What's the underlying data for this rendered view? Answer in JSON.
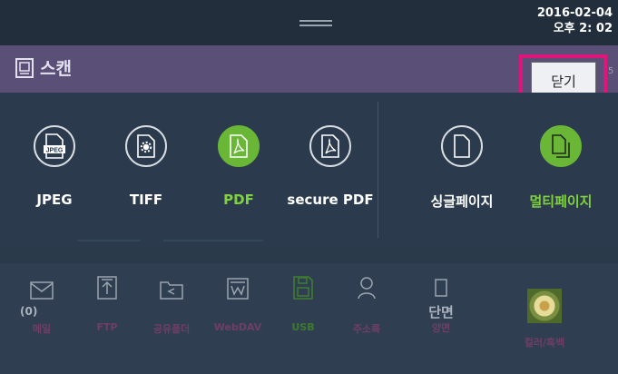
{
  "status_bar": {
    "date": "2016-02-04",
    "time": "오후 2: 02"
  },
  "header": {
    "title": "스캔",
    "close_label": "닫기",
    "edge_text": "5"
  },
  "formats": [
    {
      "label": "JPEG",
      "icon": "jpeg-file-icon",
      "icon_text": "JPEG",
      "selected": false
    },
    {
      "label": "TIFF",
      "icon": "tiff-file-icon",
      "selected": false
    },
    {
      "label": "PDF",
      "icon": "pdf-file-icon",
      "selected": true
    },
    {
      "label": "secure PDF",
      "icon": "secure-pdf-file-icon",
      "selected": false
    }
  ],
  "page_modes": [
    {
      "label": "싱글페이지",
      "icon": "single-page-icon",
      "selected": false
    },
    {
      "label": "멀티페이지",
      "icon": "multi-page-icon",
      "selected": true
    }
  ],
  "destinations": {
    "email": {
      "label": "메일",
      "count": "(0)"
    },
    "ftp": {
      "label": "FTP"
    },
    "shared_folder": {
      "label": "공유폴더"
    },
    "webdav": {
      "label": "WebDAV"
    },
    "usb": {
      "label": "USB"
    },
    "address_book": {
      "label": "주소록"
    },
    "duplex": {
      "value": "단면",
      "label": "양면"
    },
    "color": {
      "label": "컬러/흑백"
    }
  },
  "colors": {
    "accent_green": "#6ab737",
    "header_purple": "#5a5077",
    "highlight": "#e0157b"
  }
}
